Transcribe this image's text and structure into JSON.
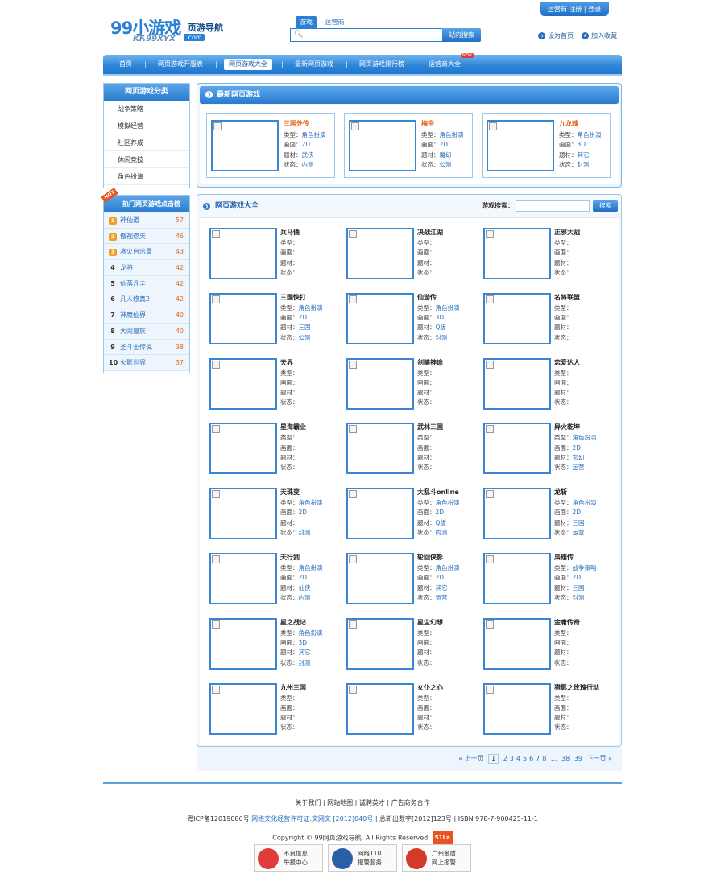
{
  "header": {
    "logo_main": "99小游戏",
    "logo_suffix": "页游导航",
    "logo_domain": "KF.99XYX",
    "logo_com": ".com",
    "search_tabs": [
      "游戏",
      "运营商"
    ],
    "search_button": "站内搜索",
    "top_links": "运营商 注册 | 登录",
    "set_home": "设为首页",
    "add_fav": "加入收藏",
    "nav": [
      "首页",
      "网页游戏开服表",
      "网页游戏大全",
      "最新网页游戏",
      "网页游戏排行榜",
      "运营商大全"
    ],
    "nav_new_badge": "NEW"
  },
  "sidebar": {
    "category_title": "网页游戏分类",
    "categories": [
      "战争策略",
      "模拟经营",
      "社区养成",
      "休闲竞技",
      "角色扮演"
    ],
    "hot_ribbon": "HOT",
    "hot_title": "热门网页游戏点击榜",
    "hot": [
      {
        "rank": "1",
        "name": "神仙道",
        "count": "57"
      },
      {
        "rank": "2",
        "name": "傲视遮天",
        "count": "46"
      },
      {
        "rank": "3",
        "name": "冰火启示录",
        "count": "43"
      },
      {
        "rank": "4",
        "name": "龙将",
        "count": "42"
      },
      {
        "rank": "5",
        "name": "仙落凡尘",
        "count": "42"
      },
      {
        "rank": "6",
        "name": "凡人修真2",
        "count": "42"
      },
      {
        "rank": "7",
        "name": "神魔仙界",
        "count": "40"
      },
      {
        "rank": "8",
        "name": "大闹皇族",
        "count": "40"
      },
      {
        "rank": "9",
        "name": "圣斗士传说",
        "count": "38"
      },
      {
        "rank": "10",
        "name": "火影世界",
        "count": "37"
      }
    ]
  },
  "labels": {
    "type": "类型：",
    "screen": "画面：",
    "theme": "题材：",
    "status": "状态："
  },
  "latest": {
    "title": "最新网页游戏",
    "games": [
      {
        "name": "三国外传",
        "type": "角色扮演",
        "screen": "2D",
        "theme": "武侠",
        "status": "内测"
      },
      {
        "name": "梅宗",
        "type": "角色扮演",
        "screen": "2D",
        "theme": "魔幻",
        "status": "公测"
      },
      {
        "name": "九龙魂",
        "type": "角色扮演",
        "screen": "3D",
        "theme": "其它",
        "status": "封测"
      }
    ]
  },
  "all": {
    "title": "网页游戏大全",
    "search_label": "游戏搜索：",
    "search_button": "搜索",
    "games": [
      {
        "name": "兵马俑",
        "type": "",
        "screen": "",
        "theme": "",
        "status": ""
      },
      {
        "name": "决战江湖",
        "type": "",
        "screen": "",
        "theme": "",
        "status": ""
      },
      {
        "name": "正邪大战",
        "type": "",
        "screen": "",
        "theme": "",
        "status": ""
      },
      {
        "name": "三国快打",
        "type": "角色扮演",
        "screen": "2D",
        "theme": "三国",
        "status": "公测"
      },
      {
        "name": "仙游传",
        "type": "角色扮演",
        "screen": "3D",
        "theme": "Q版",
        "status": "封测"
      },
      {
        "name": "名将联盟",
        "type": "",
        "screen": "",
        "theme": "",
        "status": ""
      },
      {
        "name": "天界",
        "type": "",
        "screen": "",
        "theme": "",
        "status": ""
      },
      {
        "name": "剑啸神途",
        "type": "",
        "screen": "",
        "theme": "",
        "status": ""
      },
      {
        "name": "恋爱达人",
        "type": "",
        "screen": "",
        "theme": "",
        "status": ""
      },
      {
        "name": "星海霸业",
        "type": "",
        "screen": "",
        "theme": "",
        "status": ""
      },
      {
        "name": "武林三国",
        "type": "",
        "screen": "",
        "theme": "",
        "status": ""
      },
      {
        "name": "异火乾坤",
        "type": "角色扮演",
        "screen": "2D",
        "theme": "玄幻",
        "status": "运营"
      },
      {
        "name": "天珠变",
        "type": "角色扮演",
        "screen": "2D",
        "theme": "",
        "status": "封测"
      },
      {
        "name": "大乱斗online",
        "type": "角色扮演",
        "screen": "2D",
        "theme": "Q版",
        "status": "内测"
      },
      {
        "name": "龙斩",
        "type": "角色扮演",
        "screen": "2D",
        "theme": "三国",
        "status": "运营"
      },
      {
        "name": "天行剑",
        "type": "角色扮演",
        "screen": "2D",
        "theme": "仙侠",
        "status": "内测"
      },
      {
        "name": "轮回侠影",
        "type": "角色扮演",
        "screen": "2D",
        "theme": "其它",
        "status": "运营"
      },
      {
        "name": "枭雄传",
        "type": "战争策略",
        "screen": "2D",
        "theme": "三国",
        "status": "封测"
      },
      {
        "name": "星之战记",
        "type": "角色扮演",
        "screen": "3D",
        "theme": "其它",
        "status": "封测"
      },
      {
        "name": "星尘幻想",
        "type": "",
        "screen": "",
        "theme": "",
        "status": ""
      },
      {
        "name": "金庸传奇",
        "type": "",
        "screen": "",
        "theme": "",
        "status": ""
      },
      {
        "name": "九州三国",
        "type": "",
        "screen": "",
        "theme": "",
        "status": ""
      },
      {
        "name": "女仆之心",
        "type": "",
        "screen": "",
        "theme": "",
        "status": ""
      },
      {
        "name": "猎影之玫瑰行动",
        "type": "",
        "screen": "",
        "theme": "",
        "status": ""
      }
    ]
  },
  "pager": {
    "prev": "« 上一页",
    "current": "1",
    "pages": [
      "2",
      "3",
      "4",
      "5",
      "6",
      "7",
      "8"
    ],
    "ellipsis": "...",
    "tail": [
      "38",
      "39"
    ],
    "next": "下一页 »"
  },
  "footer": {
    "links": "关于我们 | 网站地图 | 诚聘英才 | 广告商务合作",
    "icp_pre": "粤ICP备12019086号",
    "icp_link": "网络文化经营许可证:文网文 [2012]040号",
    "icp_post": "| 总新出数字[2012]123号 | ISBN 978-7-900425-11-1",
    "copyright": "Copyright © 99网页游戏导航. All Rights Reserved.",
    "stat_badge": "51La",
    "badges": [
      {
        "l1": "不良信息",
        "l2": "举报中心",
        "color": "#e23b3b"
      },
      {
        "l1": "网络110",
        "l2": "报警服务",
        "color": "#2a5fa8"
      },
      {
        "l1": "广州金盾",
        "l2": "网上报警",
        "color": "#d43a2a"
      }
    ]
  },
  "colors": {
    "accent": "#2a7fd6",
    "hot": "#e8531f",
    "link": "#2a6fbf"
  }
}
